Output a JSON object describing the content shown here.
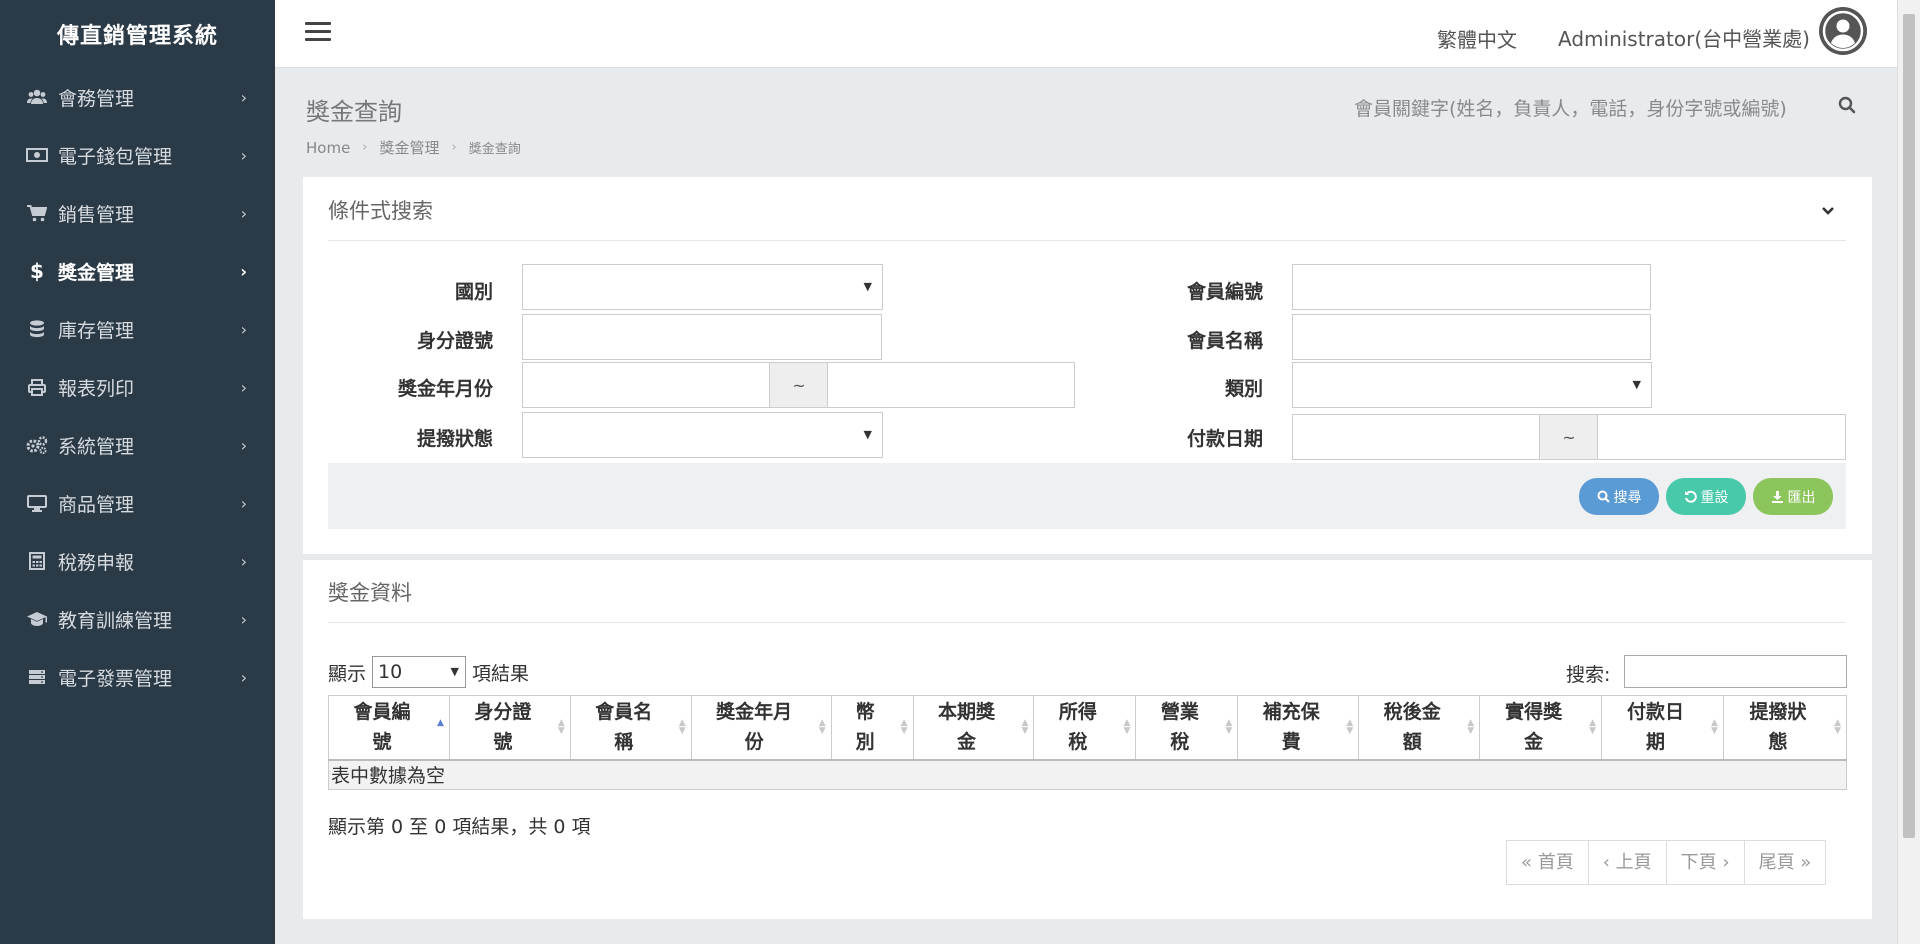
{
  "app_title": "傳直銷管理系統",
  "sidebar": {
    "items": [
      {
        "label": "會務管理",
        "icon": "users-icon"
      },
      {
        "label": "電子錢包管理",
        "icon": "money-icon"
      },
      {
        "label": "銷售管理",
        "icon": "cart-icon"
      },
      {
        "label": "獎金管理",
        "icon": "dollar-icon",
        "active": true
      },
      {
        "label": "庫存管理",
        "icon": "database-icon"
      },
      {
        "label": "報表列印",
        "icon": "print-icon"
      },
      {
        "label": "系統管理",
        "icon": "gears-icon"
      },
      {
        "label": "商品管理",
        "icon": "desktop-icon"
      },
      {
        "label": "稅務申報",
        "icon": "calculator-icon"
      },
      {
        "label": "教育訓練管理",
        "icon": "graduation-cap-icon"
      },
      {
        "label": "電子發票管理",
        "icon": "server-icon"
      }
    ]
  },
  "topbar": {
    "language": "繁體中文",
    "user": "Administrator(台中營業處)"
  },
  "page": {
    "title": "獎金查詢",
    "keyword_search_placeholder": "會員關鍵字(姓名，負責人，電話，身份字號或編號)"
  },
  "breadcrumb": [
    "Home",
    "獎金管理",
    "獎金查詢"
  ],
  "search_panel": {
    "title": "條件式搜索",
    "fields": {
      "country": "國別",
      "id_number": "身分證號",
      "bonus_month": "獎金年月份",
      "status": "提撥狀態",
      "member_no": "會員編號",
      "member_name": "會員名稱",
      "category": "類別",
      "pay_date": "付款日期"
    },
    "range_sep": "~",
    "buttons": {
      "search": "搜尋",
      "reset": "重設",
      "export": "匯出"
    }
  },
  "data_panel": {
    "title": "獎金資料",
    "length_prefix": "顯示",
    "length_value": "10",
    "length_suffix": "項結果",
    "search_label": "搜索:",
    "columns": [
      [
        "會員編",
        "號"
      ],
      [
        "身分證",
        "號"
      ],
      [
        "會員名",
        "稱"
      ],
      [
        "獎金年月",
        "份"
      ],
      [
        "幣",
        "別"
      ],
      [
        "本期獎",
        "金"
      ],
      [
        "所得",
        "稅"
      ],
      [
        "營業",
        "稅"
      ],
      [
        "補充保",
        "費"
      ],
      [
        "稅後金",
        "額"
      ],
      [
        "實得獎",
        "金"
      ],
      [
        "付款日",
        "期"
      ],
      [
        "提撥狀",
        "態"
      ]
    ],
    "empty_text": "表中數據為空",
    "info": "顯示第 0 至 0 項結果，共 0 項",
    "pager": [
      "« 首頁",
      "‹ 上頁",
      "下頁 ›",
      "尾頁 »"
    ]
  }
}
